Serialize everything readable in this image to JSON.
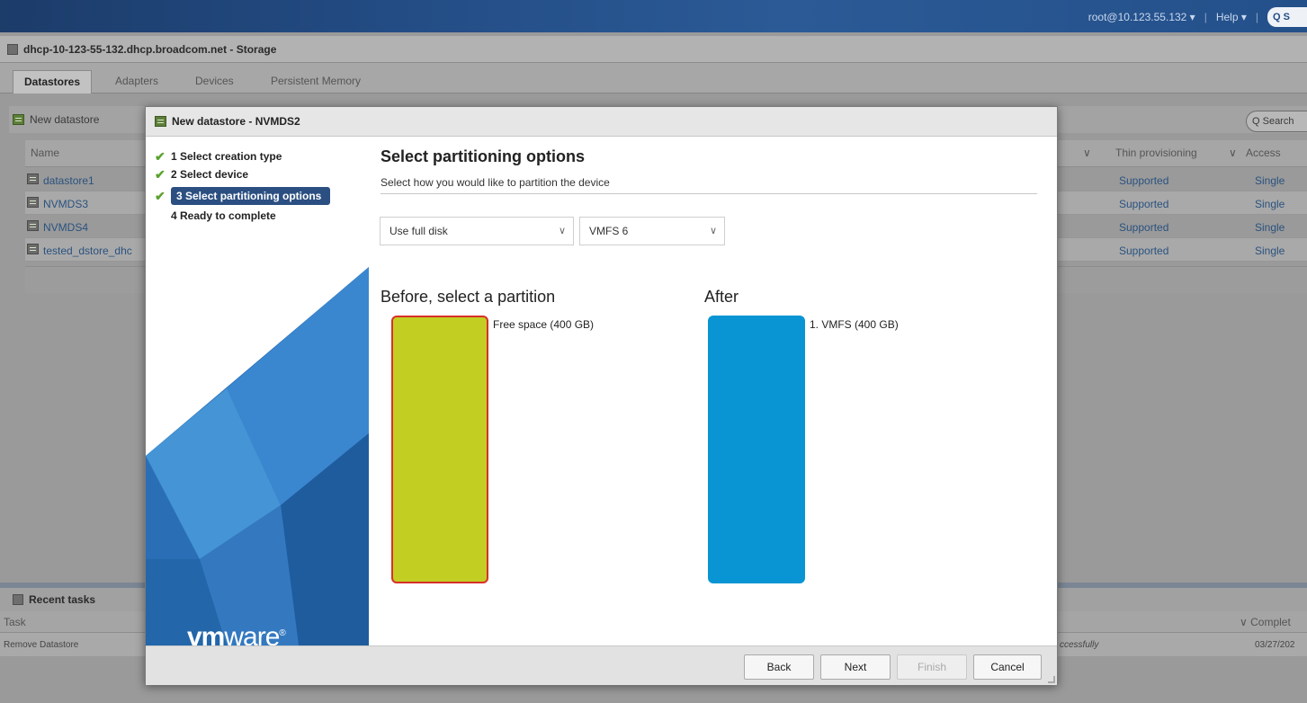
{
  "topbar": {
    "user": "root@10.123.55.132 ▾",
    "sep1": "|",
    "help": "Help ▾",
    "sep2": "|",
    "search": "Q S"
  },
  "background": {
    "host_title": "dhcp-10-123-55-132.dhcp.broadcom.net - Storage",
    "tabs": [
      {
        "label": "Datastores"
      },
      {
        "label": "Adapters"
      },
      {
        "label": "Devices"
      },
      {
        "label": "Persistent Memory"
      }
    ],
    "toolbar": {
      "new_datastore": "New datastore",
      "search": "Q Search"
    },
    "table": {
      "col_name": "Name",
      "col_thin": "Thin provisioning",
      "col_access": "Access",
      "col_sort_1": "∨",
      "col_sort_2": "∨",
      "rows": [
        {
          "name": "datastore1",
          "thin": "Supported",
          "access": "Single"
        },
        {
          "name": "NVMDS3",
          "thin": "Supported",
          "access": "Single"
        },
        {
          "name": "NVMDS4",
          "thin": "Supported",
          "access": "Single"
        },
        {
          "name": "tested_dstore_dhc",
          "thin": "Supported",
          "access": "Single"
        }
      ]
    },
    "recent_tasks": {
      "title": "Recent tasks",
      "col_task": "Task",
      "col_completed": "∨ Complet",
      "row_task": "Remove Datastore",
      "row_status": "ccessfully",
      "row_date": "03/27/202"
    }
  },
  "dialog": {
    "title": "New datastore - NVMDS2",
    "steps": [
      {
        "label": "1 Select creation type",
        "check": "✔"
      },
      {
        "label": "2 Select device",
        "check": "✔"
      },
      {
        "label": "3 Select partitioning options",
        "check": "✔"
      },
      {
        "label": "4 Ready to complete",
        "check": ""
      }
    ],
    "logo_bold": "vm",
    "logo_light": "ware",
    "logo_mark": "®",
    "heading": "Select partitioning options",
    "subheading": "Select how you would like to partition the device",
    "partition_select": {
      "value": "Use full disk",
      "caret": "∨"
    },
    "fs_select": {
      "value": "VMFS 6",
      "caret": "∨"
    },
    "before_title": "Before, select a partition",
    "after_title": "After",
    "before_partition": {
      "label": "Free space  (400 GB)",
      "color": "#c2cf22"
    },
    "after_partition": {
      "label": "1. VMFS  (400 GB)",
      "color": "#0995d4"
    },
    "buttons": {
      "back": "Back",
      "next": "Next",
      "finish": "Finish",
      "cancel": "Cancel"
    }
  }
}
